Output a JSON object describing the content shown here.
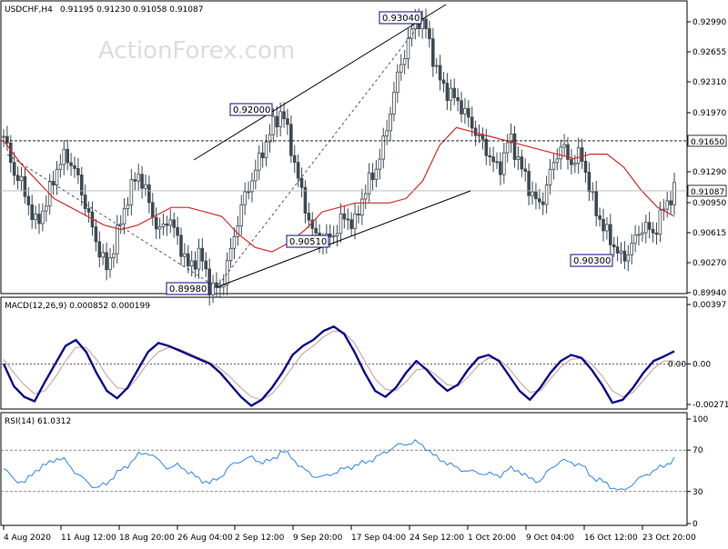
{
  "header": {
    "symbol": "USDCHF,H4",
    "ohlc": "0.91195 0.91230 0.91058 0.91087",
    "watermark": "ActionForex.com"
  },
  "macd": {
    "label": "MACD(12,26,9) 0.000852 0.000199"
  },
  "rsi": {
    "label": "RSI(14) 61.0312"
  },
  "colors": {
    "candle": "#3e4a52",
    "ma": "#d42a2a",
    "macd_line": "#0b0b8a",
    "macd_signal": "#c89a9a",
    "rsi_line": "#2f86ea",
    "annotation_border": "#0b0b8a",
    "price_tag_bg": "#ffffff"
  },
  "chart_data": [
    {
      "type": "candlestick",
      "panel": "price",
      "title": "USDCHF,H4",
      "ylim": [
        0.8994,
        0.9318
      ],
      "y_ticks": [
        "0.92990",
        "0.92655",
        "0.92310",
        "0.91970",
        "0.91290",
        "0.90950",
        "0.90615",
        "0.90270",
        "0.89940"
      ],
      "x_ticks": [
        "4 Aug 2020",
        "11 Aug 12:00",
        "18 Aug 20:00",
        "26 Aug 04:00",
        "2 Sep 12:00",
        "9 Sep 20:00",
        "17 Sep 04:00",
        "24 Sep 12:00",
        "1 Oct 20:00",
        "9 Oct 04:00",
        "16 Oct 12:00",
        "23 Oct 20:00"
      ],
      "closes_path": [
        0.917,
        0.913,
        0.911,
        0.907,
        0.909,
        0.913,
        0.915,
        0.913,
        0.909,
        0.905,
        0.902,
        0.906,
        0.91,
        0.913,
        0.91,
        0.906,
        0.908,
        0.905,
        0.902,
        0.904,
        0.9,
        0.8998,
        0.904,
        0.909,
        0.912,
        0.915,
        0.918,
        0.92,
        0.915,
        0.91,
        0.906,
        0.9051,
        0.906,
        0.908,
        0.907,
        0.911,
        0.913,
        0.917,
        0.923,
        0.927,
        0.9304,
        0.929,
        0.924,
        0.922,
        0.921,
        0.919,
        0.917,
        0.915,
        0.913,
        0.917,
        0.914,
        0.911,
        0.909,
        0.913,
        0.916,
        0.914,
        0.915,
        0.91,
        0.907,
        0.905,
        0.903,
        0.905,
        0.907,
        0.906,
        0.909,
        0.91087
      ],
      "moving_average": [
        0.9165,
        0.914,
        0.912,
        0.91,
        0.909,
        0.908,
        0.907,
        0.9065,
        0.907,
        0.908,
        0.909,
        0.909,
        0.9085,
        0.908,
        0.906,
        0.9045,
        0.904,
        0.905,
        0.9065,
        0.9085,
        0.909,
        0.9095,
        0.9095,
        0.9095,
        0.91,
        0.912,
        0.916,
        0.918,
        0.9175,
        0.917,
        0.9165,
        0.916,
        0.9155,
        0.915,
        0.9145,
        0.915,
        0.915,
        0.9135,
        0.911,
        0.909,
        0.908
      ],
      "current_price": "0.91087",
      "horizontal_level": "0.91650",
      "annotations": [
        "0.93040",
        "0.92000",
        "0.90510",
        "0.89980",
        "0.90300"
      ]
    },
    {
      "type": "line",
      "panel": "macd",
      "title": "MACD(12,26,9) 0.000852 0.000199",
      "y_ticks": [
        "0.00397",
        "0.00",
        "-0.002713"
      ],
      "series": [
        {
          "name": "MACD",
          "values": [
            0.0,
            -0.0015,
            -0.0022,
            -0.0025,
            -0.0012,
            0.0,
            0.0012,
            0.0016,
            0.0008,
            -0.0006,
            -0.0018,
            -0.0023,
            -0.0016,
            -0.0004,
            0.0008,
            0.0014,
            0.0012,
            0.0009,
            0.0006,
            0.0003,
            0.0,
            -0.0006,
            -0.0014,
            -0.0022,
            -0.0028,
            -0.0024,
            -0.0016,
            -0.0006,
            0.0006,
            0.0012,
            0.0016,
            0.0022,
            0.0025,
            0.002,
            0.0008,
            -0.0006,
            -0.0018,
            -0.0022,
            -0.0016,
            -0.0006,
            0.0002,
            -0.0004,
            -0.0012,
            -0.0018,
            -0.0014,
            -0.0004,
            0.0004,
            0.0006,
            0.0002,
            -0.0008,
            -0.0018,
            -0.0024,
            -0.0016,
            -0.0006,
            0.0002,
            0.0006,
            0.0004,
            -0.0004,
            -0.0014,
            -0.0026,
            -0.0024,
            -0.0016,
            -0.0006,
            0.0002,
            0.0005,
            0.00085
          ]
        },
        {
          "name": "Signal",
          "values": [
            0.0003,
            -0.0006,
            -0.0014,
            -0.002,
            -0.0018,
            -0.0009,
            0.0002,
            0.0011,
            0.0011,
            0.0003,
            -0.0008,
            -0.0016,
            -0.0017,
            -0.0009,
            0.0001,
            0.0008,
            0.0011,
            0.001,
            0.0007,
            0.0004,
            0.0001,
            -0.0003,
            -0.0009,
            -0.0016,
            -0.0022,
            -0.0024,
            -0.002,
            -0.0012,
            -0.0002,
            0.0007,
            0.0012,
            0.0018,
            0.0022,
            0.0021,
            0.0014,
            0.0002,
            -0.001,
            -0.0017,
            -0.0018,
            -0.0012,
            -0.0004,
            -0.0003,
            -0.0008,
            -0.0014,
            -0.0015,
            -0.0009,
            -0.0001,
            0.0004,
            0.0003,
            -0.0003,
            -0.0012,
            -0.0019,
            -0.0018,
            -0.001,
            -0.0002,
            0.0003,
            0.0004,
            0.0,
            -0.0008,
            -0.0018,
            -0.0022,
            -0.0019,
            -0.0011,
            -0.0003,
            0.0002,
            0.0002
          ]
        }
      ]
    },
    {
      "type": "line",
      "panel": "rsi",
      "title": "RSI(14) 61.0312",
      "ylim": [
        0,
        100
      ],
      "y_ticks": [
        "100",
        "70",
        "30",
        "0"
      ],
      "series": [
        {
          "name": "RSI(14)",
          "values": [
            52,
            42,
            38,
            50,
            55,
            62,
            60,
            48,
            40,
            33,
            38,
            48,
            55,
            65,
            68,
            60,
            52,
            56,
            48,
            42,
            38,
            44,
            55,
            60,
            63,
            58,
            60,
            70,
            62,
            52,
            45,
            44,
            48,
            52,
            55,
            58,
            62,
            68,
            74,
            76,
            78,
            72,
            62,
            58,
            52,
            50,
            48,
            47,
            45,
            52,
            50,
            42,
            40,
            52,
            60,
            58,
            56,
            44,
            40,
            34,
            30,
            38,
            45,
            50,
            55,
            61
          ]
        }
      ]
    }
  ]
}
